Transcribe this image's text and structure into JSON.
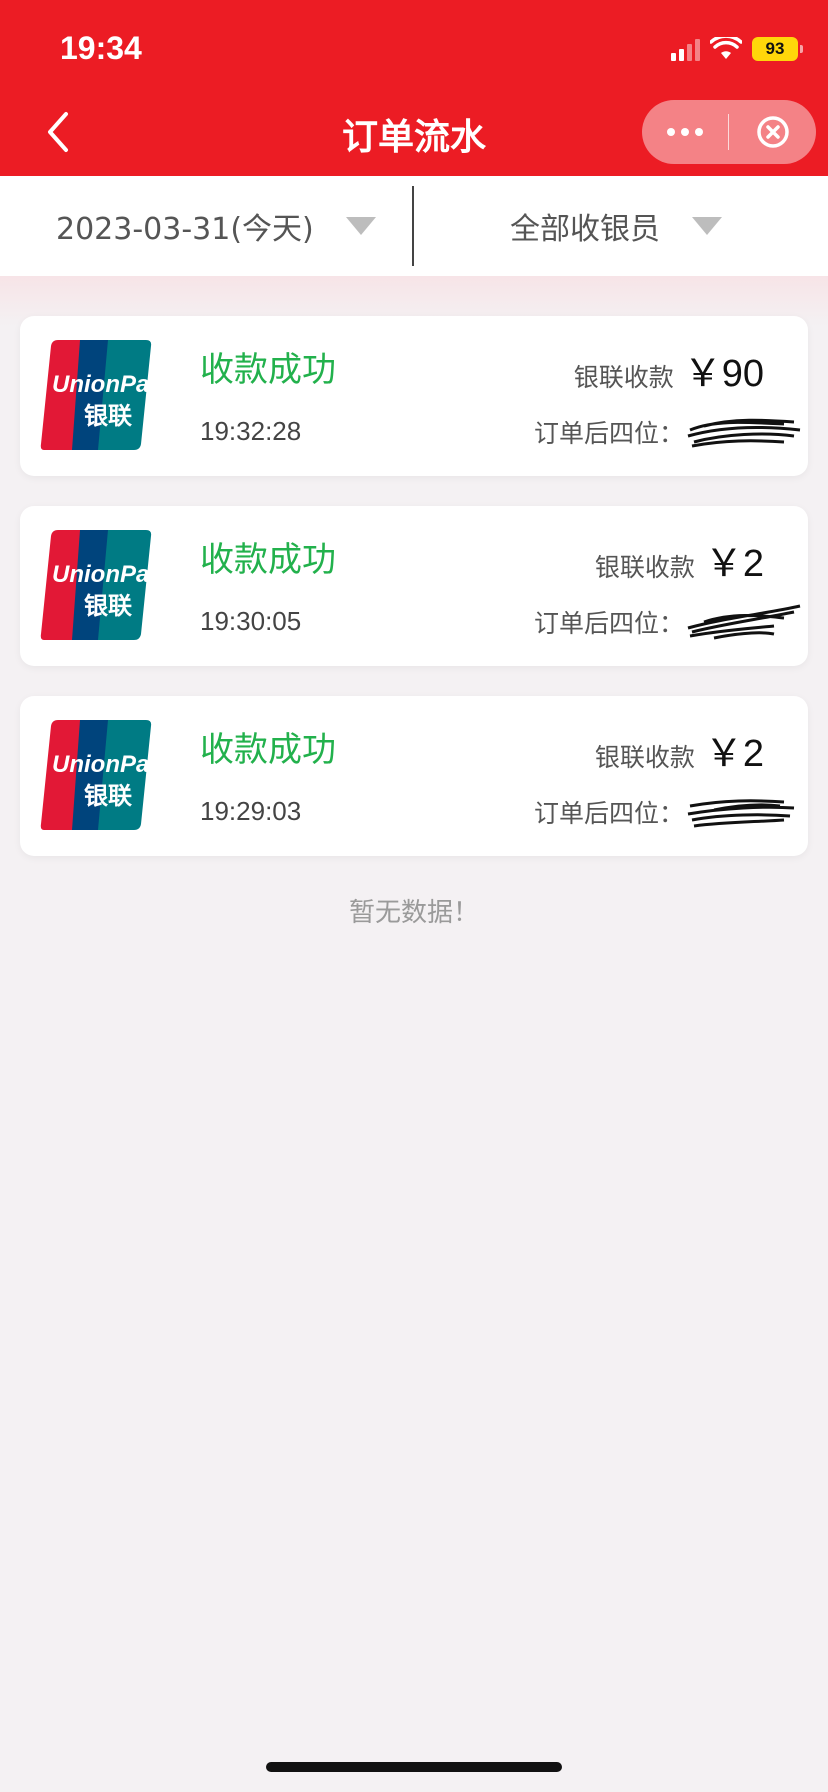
{
  "status_bar": {
    "time": "19:34",
    "battery": "93"
  },
  "nav": {
    "title": "订单流水"
  },
  "filters": {
    "date": "2023-03-31(今天)",
    "cashier": "全部收银员"
  },
  "colors": {
    "header": "#ec1c24",
    "success": "#22b14c"
  },
  "orders": [
    {
      "status": "收款成功",
      "time": "19:32:28",
      "method": "银联收款",
      "amount": "￥90",
      "order_label": "订单后四位："
    },
    {
      "status": "收款成功",
      "time": "19:30:05",
      "method": "银联收款",
      "amount": "￥2",
      "order_label": "订单后四位："
    },
    {
      "status": "收款成功",
      "time": "19:29:03",
      "method": "银联收款",
      "amount": "￥2",
      "order_label": "订单后四位："
    }
  ],
  "empty_text": "暂无数据！",
  "icons": [
    "back-arrow-icon",
    "more-dots-icon",
    "close-circle-icon",
    "unionpay-logo",
    "dropdown-triangle-icon",
    "wifi-icon",
    "signal-icon"
  ]
}
